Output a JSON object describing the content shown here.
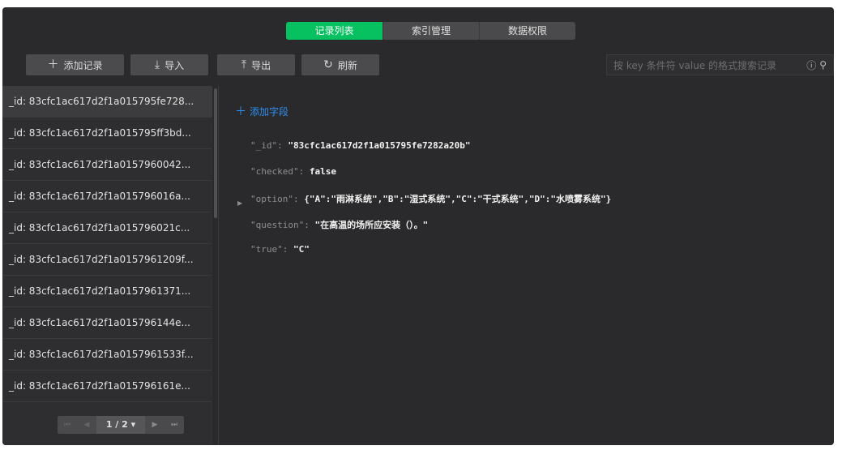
{
  "tabs": [
    {
      "label": "记录列表",
      "active": true
    },
    {
      "label": "索引管理",
      "active": false
    },
    {
      "label": "数据权限",
      "active": false
    }
  ],
  "toolbar": {
    "add_label": "添加记录",
    "import_label": "导入",
    "export_label": "导出",
    "refresh_label": "刷新",
    "search_placeholder": "按 key 条件符 value 的格式搜索记录"
  },
  "records": [
    "_id: 83cfc1ac617d2f1a015795fe728...",
    "_id: 83cfc1ac617d2f1a015795ff3bd...",
    "_id: 83cfc1ac617d2f1a0157960042...",
    "_id: 83cfc1ac617d2f1a015796016a...",
    "_id: 83cfc1ac617d2f1a015796021c...",
    "_id: 83cfc1ac617d2f1a0157961209f...",
    "_id: 83cfc1ac617d2f1a0157961371...",
    "_id: 83cfc1ac617d2f1a015796144e...",
    "_id: 83cfc1ac617d2f1a0157961533f...",
    "_id: 83cfc1ac617d2f1a015796161e..."
  ],
  "pagination": {
    "label": "1 / 2 ▾"
  },
  "detail": {
    "add_field_label": "添加字段",
    "fields": [
      {
        "key": "\"_id\"",
        "value": "\"83cfc1ac617d2f1a015795fe7282a20b\""
      },
      {
        "key": "\"checked\"",
        "value": "false"
      },
      {
        "key": "\"option\"",
        "value": "{\"A\":\"雨淋系统\",\"B\":\"湿式系统\",\"C\":\"干式系统\",\"D\":\"水喷雾系统\"}"
      },
      {
        "key": "\"question\"",
        "value": "\"在高温的场所应安装（）。\""
      },
      {
        "key": "\"true\"",
        "value": "\"C\""
      }
    ]
  },
  "colors": {
    "accent": "#07c160",
    "link": "#2e8ff0",
    "panel": "#2a2a2c"
  }
}
